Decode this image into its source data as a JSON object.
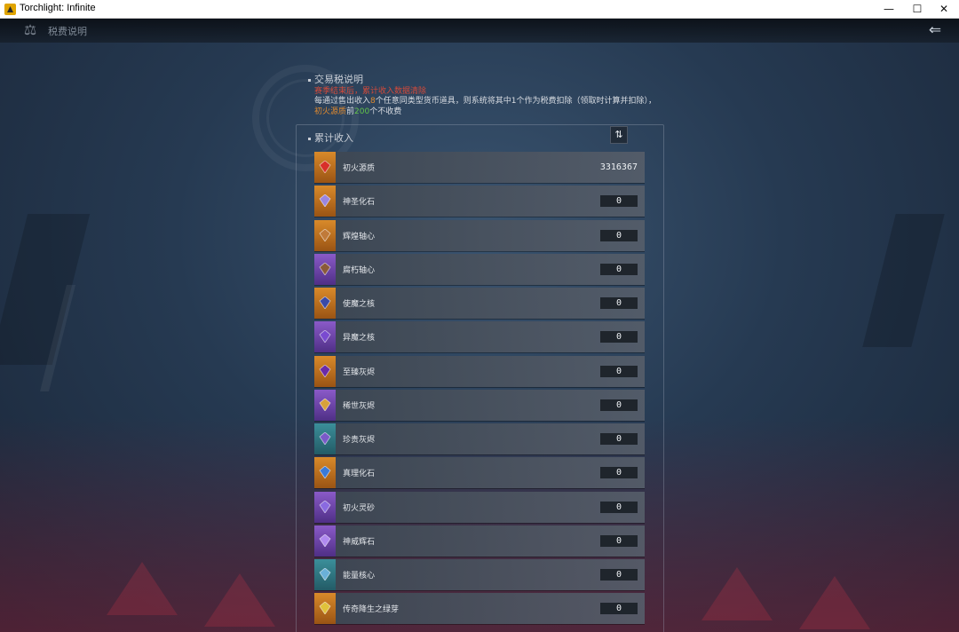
{
  "window": {
    "title": "Torchlight: Infinite",
    "min_glyph": "—",
    "max_glyph": "☐",
    "close_glyph": "✕"
  },
  "topbar": {
    "title": "税费说明",
    "back_glyph": "⇐",
    "scale_glyph": "⚖"
  },
  "tax_info": {
    "heading": "交易税说明",
    "warning": "赛季结束后，累计收入数据清除",
    "desc_a": "每通过售出收入",
    "desc_num8": "8",
    "desc_b": "个任意同类型货币道具，则系统将其中1个作为税费扣除（领取时计算并扣除），",
    "desc_item": "初火源质",
    "desc_c": "前",
    "desc_num200": "200",
    "desc_d": "个不收费"
  },
  "income": {
    "heading": "累计收入",
    "sort_glyph": "⇅",
    "items": [
      {
        "name": "初火源质",
        "value": "3316367",
        "icon": "red-crystal-icon",
        "tone": "orange",
        "color": "#d8302a"
      },
      {
        "name": "神圣化石",
        "value": "0",
        "icon": "holy-fossil-icon",
        "tone": "orange",
        "color": "#9a86e0"
      },
      {
        "name": "辉煌轴心",
        "value": "0",
        "icon": "glorious-axis-icon",
        "tone": "orange",
        "color": "#c07a3a"
      },
      {
        "name": "腐朽轴心",
        "value": "0",
        "icon": "decayed-axis-icon",
        "tone": "purple",
        "color": "#8a5a3a"
      },
      {
        "name": "使魔之核",
        "value": "0",
        "icon": "familiar-core-icon",
        "tone": "orange",
        "color": "#3a4aa8"
      },
      {
        "name": "异魔之核",
        "value": "0",
        "icon": "demon-core-icon",
        "tone": "purple",
        "color": "#7a4ad0"
      },
      {
        "name": "至臻灰烬",
        "value": "0",
        "icon": "supreme-ash-icon",
        "tone": "orange",
        "color": "#6a2aa8"
      },
      {
        "name": "稀世灰烬",
        "value": "0",
        "icon": "rare-ash-icon",
        "tone": "purple",
        "color": "#d8a23a"
      },
      {
        "name": "珍贵灰烬",
        "value": "0",
        "icon": "precious-ash-icon",
        "tone": "teal",
        "color": "#7a5ac8"
      },
      {
        "name": "真理化石",
        "value": "0",
        "icon": "truth-fossil-icon",
        "tone": "orange",
        "color": "#3a7ad8"
      },
      {
        "name": "初火灵砂",
        "value": "0",
        "icon": "spirit-sand-icon",
        "tone": "purple",
        "color": "#8a6ae0"
      },
      {
        "name": "神威辉石",
        "value": "0",
        "icon": "divine-stone-icon",
        "tone": "purple",
        "color": "#b08af0"
      },
      {
        "name": "能量核心",
        "value": "0",
        "icon": "energy-core-icon",
        "tone": "teal",
        "color": "#6ab0d8"
      },
      {
        "name": "传奇降生之绿芽",
        "value": "0",
        "icon": "legendary-sprout-icon",
        "tone": "orange",
        "color": "#e0c23a"
      }
    ]
  }
}
